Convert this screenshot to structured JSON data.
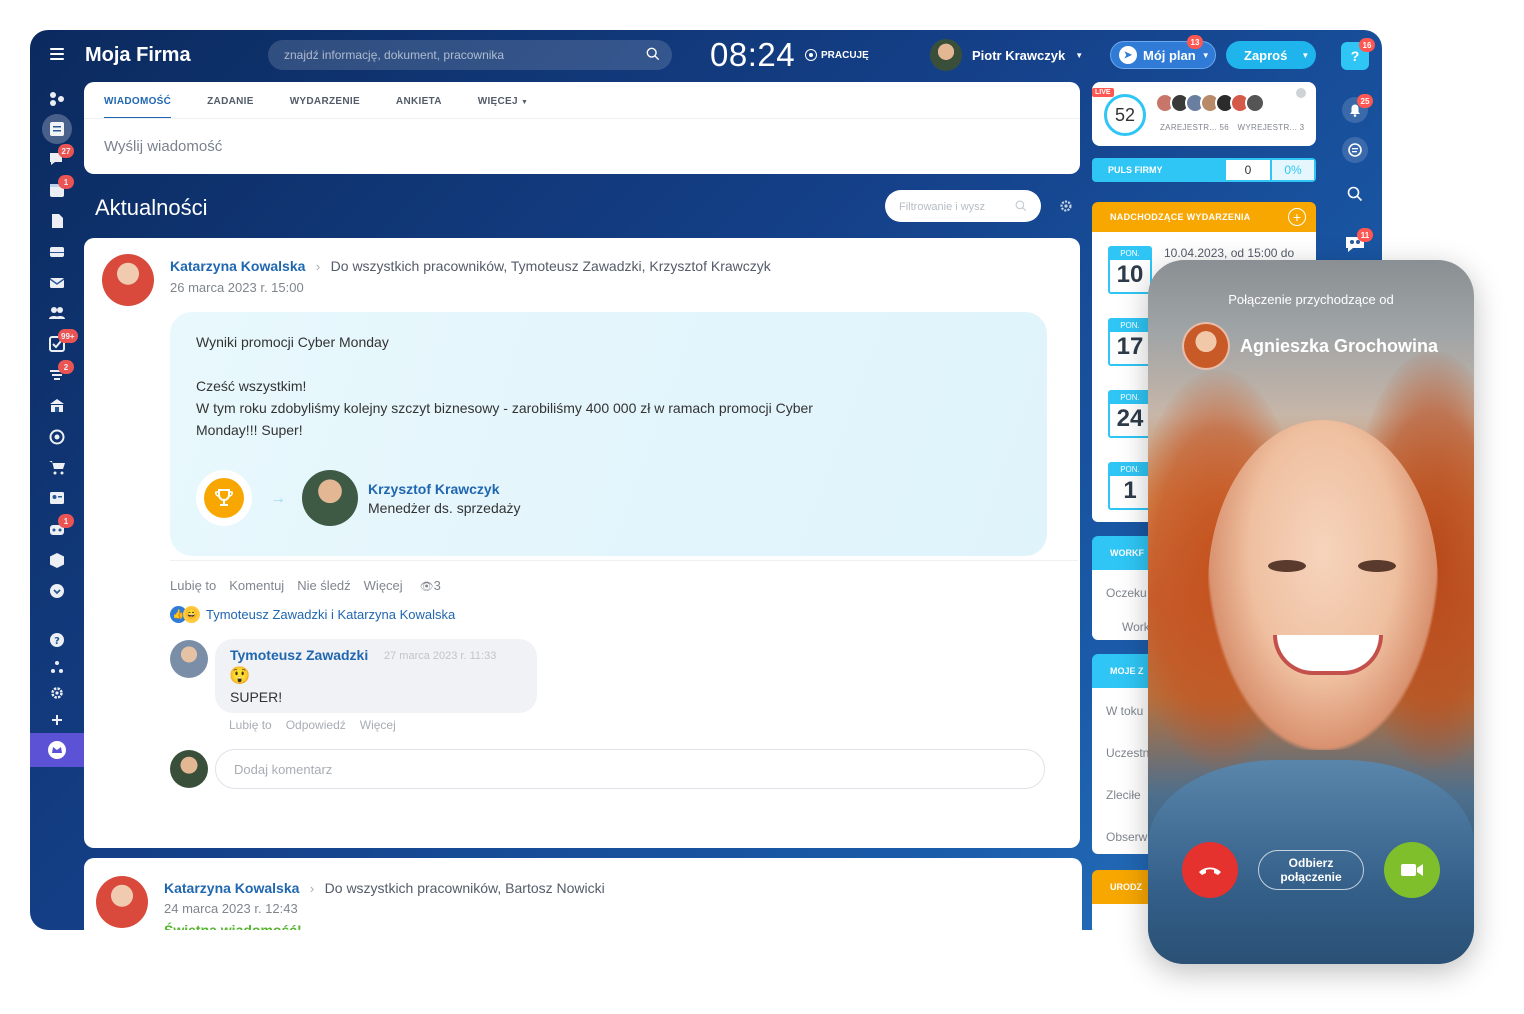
{
  "header": {
    "app_name": "Moja Firma",
    "search_placeholder": "znajdź informację, dokument, pracownika",
    "time": "08:24",
    "work_status": "PRACUJĘ",
    "user_name": "Piotr Krawczyk",
    "plan_label": "Mój plan",
    "plan_badge": "13",
    "invite_label": "Zaproś",
    "help_badge": "16"
  },
  "sidebar": {
    "badges": {
      "chat": "27",
      "calendar": "1",
      "tasks": "99+",
      "filters": "2",
      "bot": "1"
    }
  },
  "composer": {
    "tabs": [
      "WIADOMOŚĆ",
      "ZADANIE",
      "WYDARZENIE",
      "ANKIETA",
      "WIĘCEJ"
    ],
    "placeholder": "Wyślij wiadomość"
  },
  "feed": {
    "title": "Aktualności",
    "filter_placeholder": "Filtrowanie i wysz"
  },
  "post": {
    "author": "Katarzyna Kowalska",
    "destination": "Do wszystkich pracowników, Tymoteusz Zawadzki, Krzysztof Krawczyk",
    "date": "26 marca 2023 r. 15:00",
    "title": "Wyniki promocji Cyber Monday",
    "greeting": "Cześć wszystkim!",
    "body_line1": "W tym roku zdobyliśmy kolejny szczyt biznesowy - zarobiliśmy 400 000 zł w ramach promocji Cyber",
    "body_line2": "Monday!!! Super!",
    "recipient_name": "Krzysztof Krawczyk",
    "recipient_role": "Menedżer ds. sprzedaży",
    "actions": [
      "Lubię to",
      "Komentuj",
      "Nie śledź",
      "Więcej"
    ],
    "views": "3",
    "liked_by": "Tymoteusz Zawadzki i Katarzyna Kowalska",
    "comment": {
      "author": "Tymoteusz Zawadzki",
      "date": "27 marca 2023 r. 11:33",
      "emoji": "😲",
      "text": "SUPER!",
      "actions": [
        "Lubię to",
        "Odpowiedź",
        "Więcej"
      ]
    },
    "add_comment_placeholder": "Dodaj komentarz"
  },
  "post2": {
    "author": "Katarzyna Kowalska",
    "destination": "Do wszystkich pracowników, Bartosz Nowicki",
    "date": "24 marca 2023 r. 12:43",
    "title": "Świetna wiadomość!"
  },
  "right_panel": {
    "live_label": "LIVE",
    "live_count": "52",
    "registered": "ZAREJESTR... 56",
    "unregistered": "WYREJESTR... 3",
    "pulse_label": "PULS FIRMY",
    "pulse_value": "0",
    "pulse_percent": "0%",
    "events_label": "NADCHODZĄCE WYDARZENIA",
    "events": [
      {
        "day": "PON.",
        "num": "10",
        "text": "10.04.2023, od 15:00 do"
      },
      {
        "day": "PON.",
        "num": "17"
      },
      {
        "day": "PON.",
        "num": "24"
      },
      {
        "day": "PON.",
        "num": "1"
      }
    ],
    "workflow_label": "WORKF",
    "workflow_items": [
      "Oczeku",
      "Work"
    ],
    "tasks_label": "MOJE Z",
    "task_items": [
      "W toku",
      "Uczestn",
      "Zleciłe",
      "Obserw"
    ],
    "birthdays_label": "URODZ"
  },
  "right_rail": {
    "bell_badge": "25",
    "group_badge": "11"
  },
  "call": {
    "title": "Połączenie przychodzące od",
    "caller": "Agnieszka Grochowina",
    "accept_line1": "Odbierz",
    "accept_line2": "połączenie"
  },
  "colors": {
    "primary": "#2067b0",
    "accent": "#2fc6f6",
    "orange": "#f7a700",
    "danger": "#e5322e",
    "success": "#7fbf2c"
  }
}
